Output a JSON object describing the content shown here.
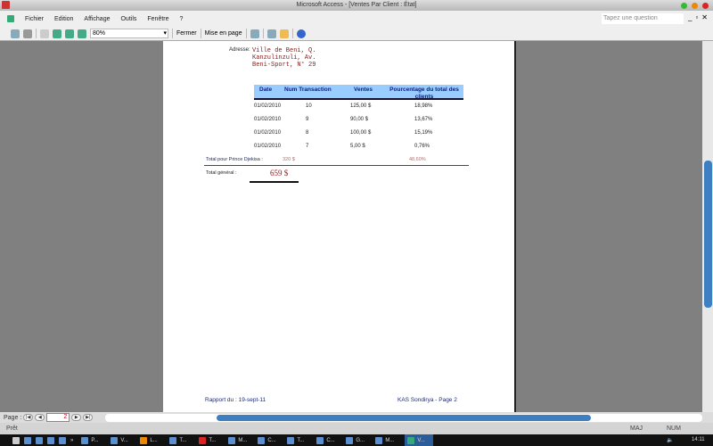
{
  "window": {
    "title": "Microsoft Access - [Ventes Par Client : État]",
    "question_placeholder": "Tapez une question"
  },
  "menu": [
    "Fichier",
    "Edition",
    "Affichage",
    "Outils",
    "Fenêtre",
    "?"
  ],
  "toolbar": {
    "zoom": "80%",
    "close_label": "Fermer",
    "page_setup_label": "Mise en page"
  },
  "report": {
    "address_label": "Adresse:",
    "address_lines": [
      "Ville de Beni, Q.",
      "Kanzulinzuli, Av.",
      "Beni-Sport, N° 29"
    ],
    "headers": [
      "Date",
      "Num Transaction",
      "Ventes",
      "Pourcentage du total des clients"
    ],
    "rows": [
      {
        "date": "01/02/2010",
        "num": "10",
        "ventes": "125,00 $",
        "pct": "18,98%"
      },
      {
        "date": "01/02/2010",
        "num": "9",
        "ventes": "90,00 $",
        "pct": "13,67%"
      },
      {
        "date": "01/02/2010",
        "num": "8",
        "ventes": "100,00 $",
        "pct": "15,19%"
      },
      {
        "date": "01/02/2010",
        "num": "7",
        "ventes": "5,00 $",
        "pct": "0,76%"
      }
    ],
    "subtotal_label": "Total pour Prince Djekisa :",
    "subtotal_value": "320 $",
    "subtotal_pct": "48,60%",
    "grand_total_label": "Total général :",
    "grand_total_value": "659 $",
    "footer_left": "Rapport du : 19-sept-11",
    "footer_right": "KAS Sondirya -  Page 2"
  },
  "nav": {
    "label": "Page :",
    "page": "2"
  },
  "status": {
    "text": "Prêt",
    "caps": "MAJ",
    "num": "NUM"
  },
  "taskbar": {
    "tasks": [
      "P...",
      "V...",
      "L...",
      "T...",
      "T...",
      "M...",
      "C...",
      "T...",
      "C...",
      "G...",
      "M...",
      "V..."
    ],
    "clock": "14:11"
  }
}
